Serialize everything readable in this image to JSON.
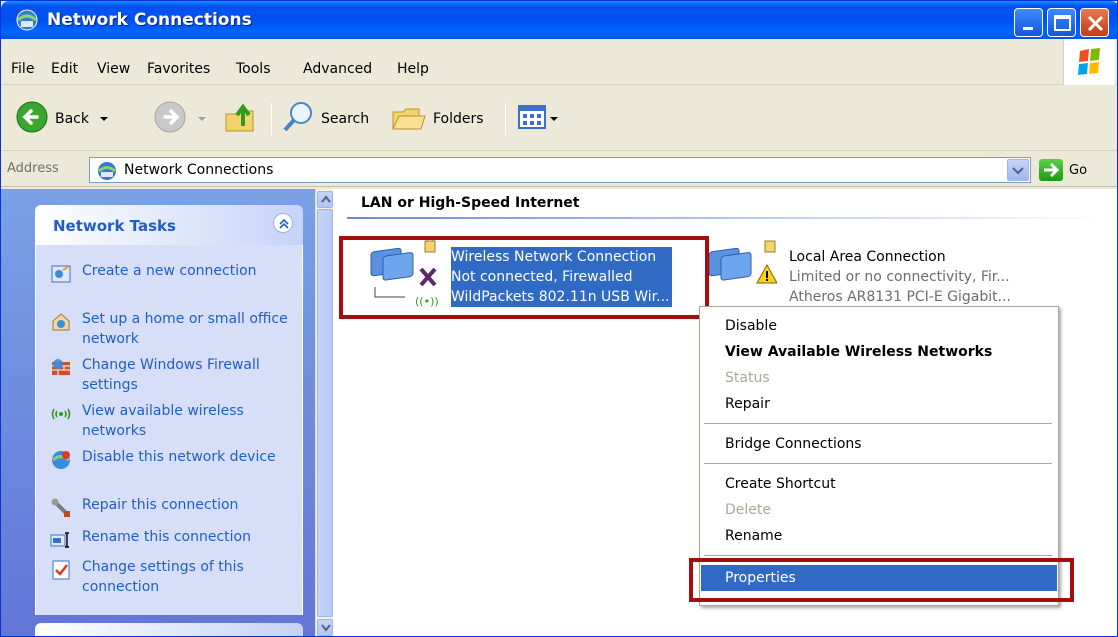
{
  "window": {
    "title": "Network Connections",
    "app_icon": "network-connections-icon"
  },
  "menu": [
    "File",
    "Edit",
    "View",
    "Favorites",
    "Tools",
    "Advanced",
    "Help"
  ],
  "toolbar": {
    "back_label": "Back",
    "search_label": "Search",
    "folders_label": "Folders"
  },
  "address": {
    "label": "Address",
    "value": "Network Connections",
    "go_label": "Go"
  },
  "taskpane": {
    "title": "Network Tasks",
    "tasks": [
      {
        "label": "Create a new connection",
        "icon": "new-connection-icon"
      },
      {
        "label": "Set up a home or small office network",
        "icon": "home-network-icon"
      },
      {
        "label": "Change Windows Firewall settings",
        "icon": "firewall-icon"
      },
      {
        "label": "View available wireless networks",
        "icon": "wireless-icon"
      },
      {
        "label": "Disable this network device",
        "icon": "disable-network-icon"
      },
      {
        "label": "Repair this connection",
        "icon": "repair-icon"
      },
      {
        "label": "Rename this connection",
        "icon": "rename-icon"
      },
      {
        "label": "Change settings of this connection",
        "icon": "settings-icon"
      }
    ]
  },
  "main": {
    "group_title": "LAN or High-Speed Internet",
    "connections": [
      {
        "name": "Wireless Network Connection",
        "status": "Not connected, Firewalled",
        "device": "WildPackets 802.11n USB Wir...",
        "selected": true
      },
      {
        "name": "Local Area Connection",
        "status": "Limited or no connectivity, Fir...",
        "device": "Atheros AR8131 PCI-E Gigabit...",
        "selected": false
      }
    ]
  },
  "context_menu": {
    "items": [
      {
        "label": "Disable",
        "state": "normal"
      },
      {
        "label": "View Available Wireless Networks",
        "state": "bold"
      },
      {
        "label": "Status",
        "state": "disabled"
      },
      {
        "label": "Repair",
        "state": "normal"
      },
      {
        "label": "Bridge Connections",
        "state": "normal"
      },
      {
        "label": "Create Shortcut",
        "state": "normal"
      },
      {
        "label": "Delete",
        "state": "disabled"
      },
      {
        "label": "Rename",
        "state": "normal"
      },
      {
        "label": "Properties",
        "state": "hover"
      }
    ]
  },
  "colors": {
    "titlebar": "#0055e0",
    "selection": "#316ac5",
    "highlight_box": "#a50e0e",
    "task_link": "#215dc6"
  }
}
